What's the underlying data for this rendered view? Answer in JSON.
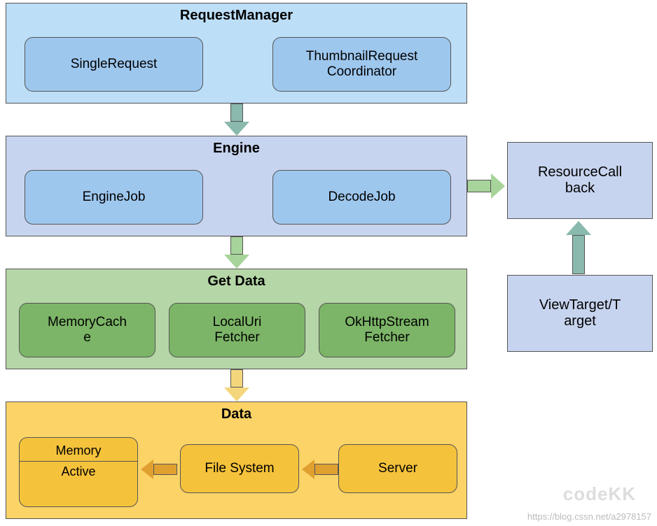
{
  "requestManager": {
    "title": "RequestManager",
    "items": [
      "SingleRequest",
      "ThumbnailRequest\nCoordinator"
    ]
  },
  "engine": {
    "title": "Engine",
    "items": [
      "EngineJob",
      "DecodeJob"
    ]
  },
  "getData": {
    "title": "Get Data",
    "items": [
      "MemoryCach\ne",
      "LocalUri\nFetcher",
      "OkHttpStream\nFetcher"
    ]
  },
  "data": {
    "title": "Data",
    "memory": {
      "top": "Memory",
      "bottom": "Active"
    },
    "items": [
      "File System",
      "Server"
    ]
  },
  "resourceCallback": "ResourceCall\nback",
  "viewTarget": "ViewTarget/T\narget",
  "watermark_url": "https://blog.cssn.net/a2978157",
  "watermark_logo": "codeKK"
}
